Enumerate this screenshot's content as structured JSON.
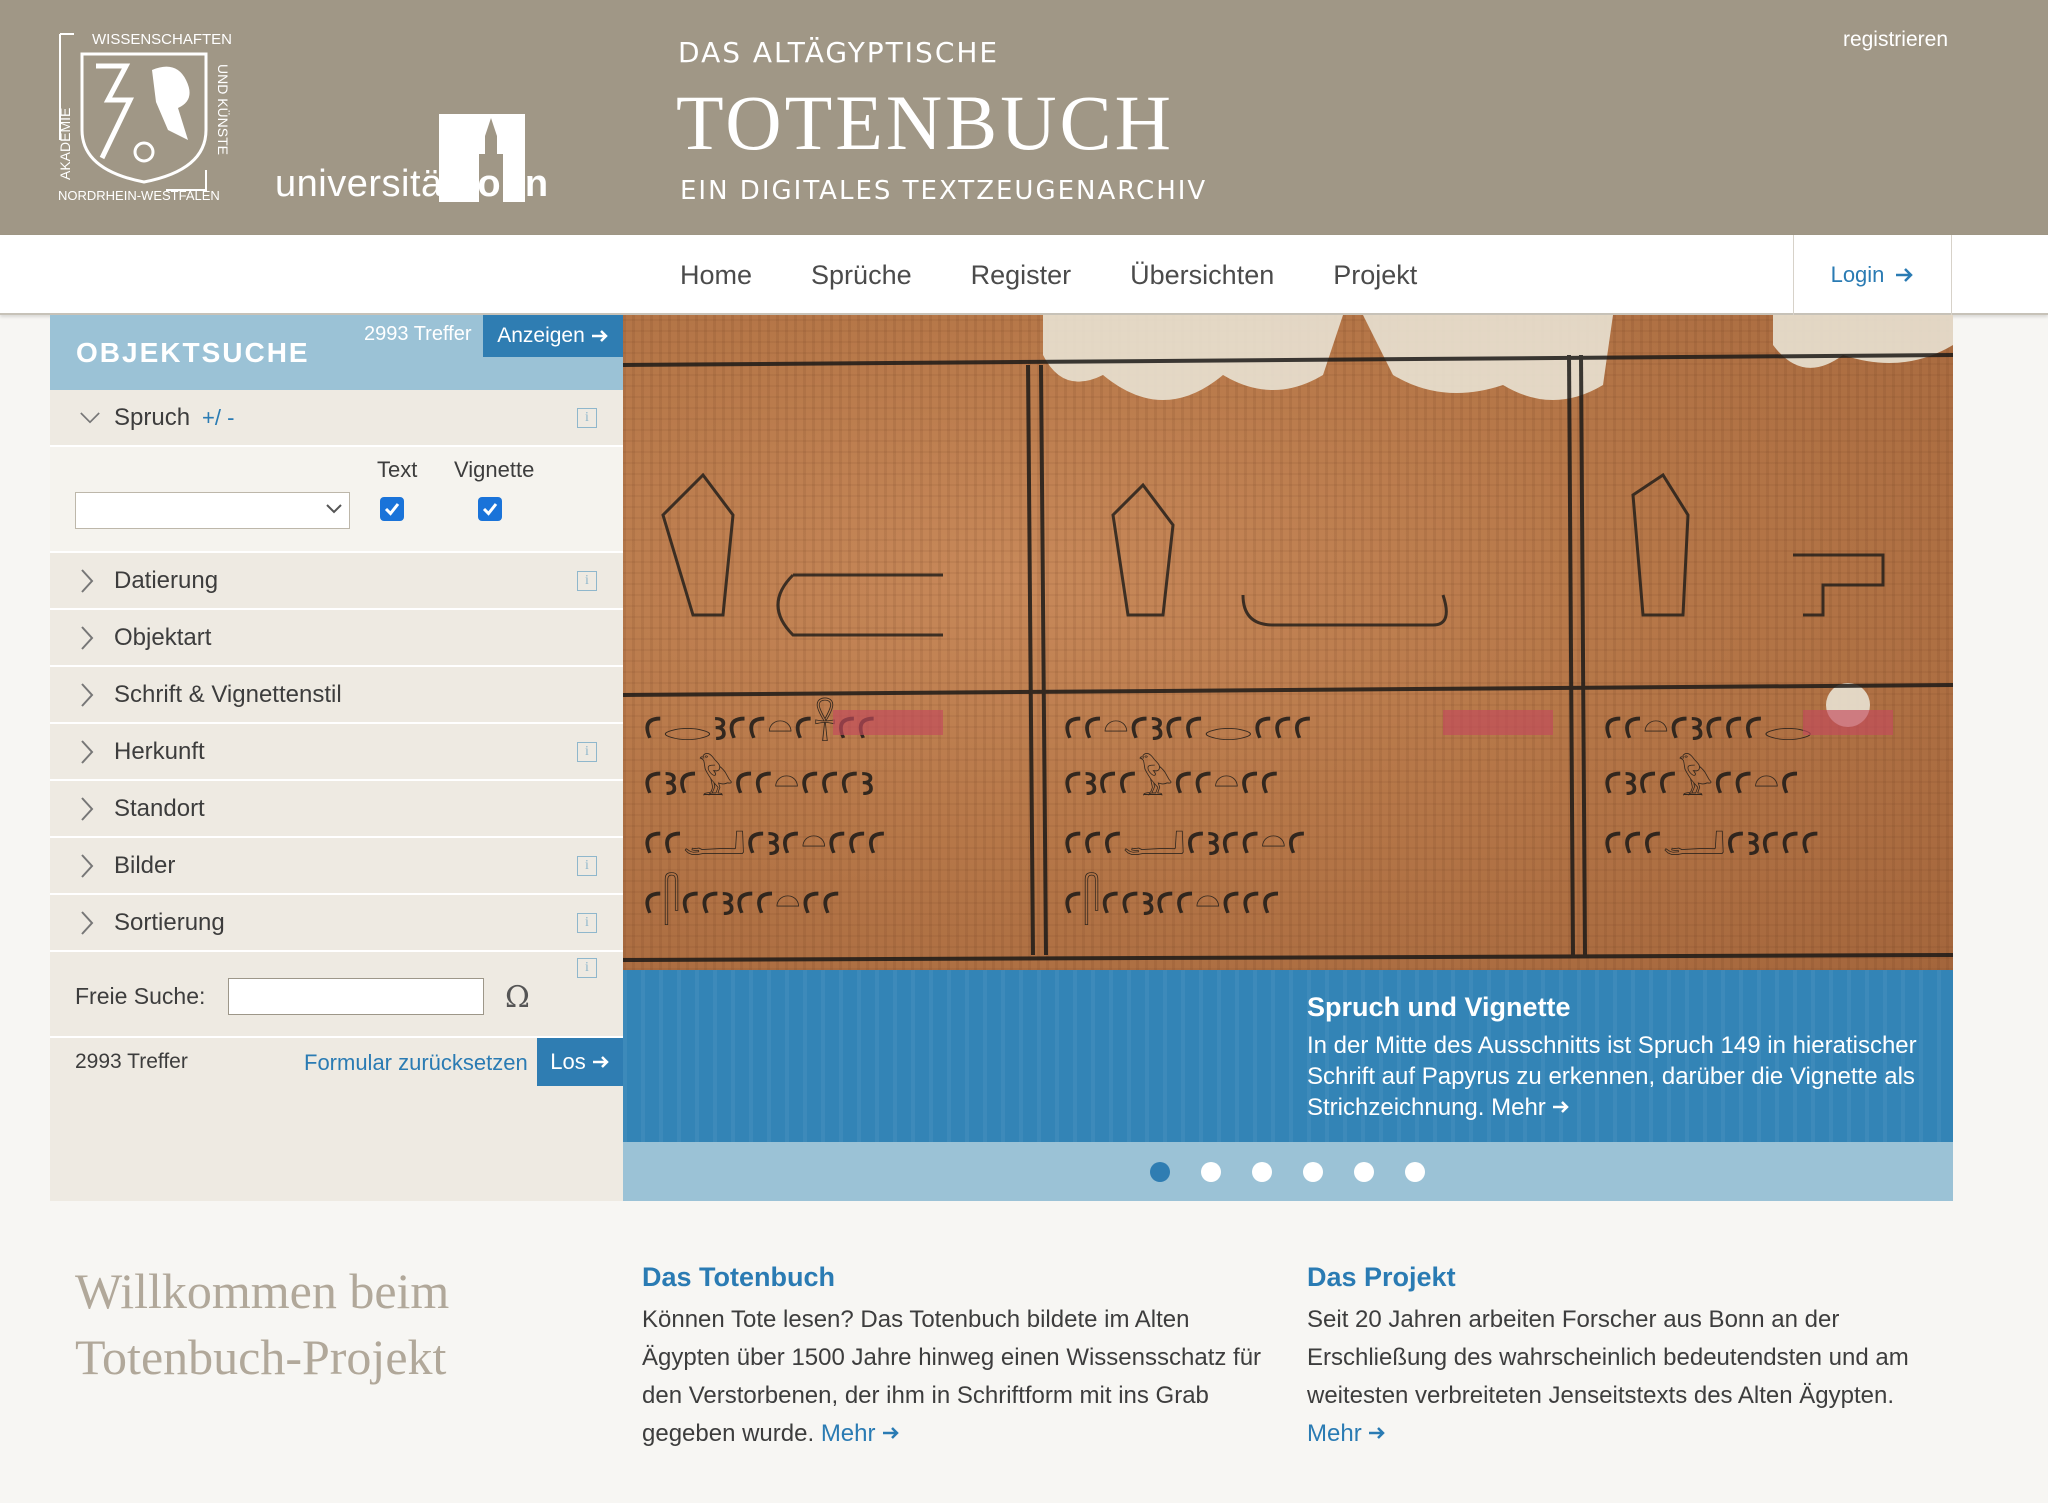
{
  "header": {
    "akademie_logo_text": [
      "WISSENSCHAFTEN",
      "UND KÜNSTE",
      "AKADEMIE",
      "NORDRHEIN-WESTFALEN"
    ],
    "bonn_logo": {
      "light": "universität",
      "bold": "bonn"
    },
    "title_small": "DAS ALTÄGYPTISCHE",
    "title_big": "TOTENBUCH",
    "title_sub": "EIN DIGITALES TEXTZEUGENARCHIV",
    "register_link": "registrieren"
  },
  "nav": {
    "items": [
      "Home",
      "Sprüche",
      "Register",
      "Übersichten",
      "Projekt"
    ],
    "login": "Login"
  },
  "sidebar": {
    "title": "OBJEKTSUCHE",
    "hits_top": "2993 Treffer",
    "show_button": "Anzeigen",
    "spruch": {
      "label": "Spruch",
      "plus_minus": "+/ -",
      "text_label": "Text",
      "vignette_label": "Vignette",
      "text_checked": true,
      "vignette_checked": true,
      "select_value": ""
    },
    "sections": [
      {
        "label": "Datierung",
        "info": true
      },
      {
        "label": "Objektart",
        "info": false
      },
      {
        "label": "Schrift & Vignettenstil",
        "info": false
      },
      {
        "label": "Herkunft",
        "info": true
      },
      {
        "label": "Standort",
        "info": false
      },
      {
        "label": "Bilder",
        "info": true
      },
      {
        "label": "Sortierung",
        "info": true
      }
    ],
    "free_search": {
      "label": "Freie Suche:",
      "value": "",
      "omega": "Ω"
    },
    "hits_bottom": "2993 Treffer",
    "reset_link": "Formular zurücksetzen",
    "go_button": "Los"
  },
  "slider": {
    "caption_title": "Spruch und Vignette",
    "caption_text": "In der Mitte des Ausschnitts ist Spruch 149 in hieratischer Schrift auf Papyrus zu erkennen, darüber die Vignette als Strichzeichnung.",
    "caption_more": "Mehr",
    "slide_count": 6,
    "active_slide": 1
  },
  "welcome": {
    "line1": "Willkommen beim",
    "line2": "Totenbuch-Projekt"
  },
  "columns": [
    {
      "title": "Das Totenbuch",
      "text": "Können Tote lesen? Das Totenbuch bildete im Alten Ägypten über 1500 Jahre hinweg einen Wissensschatz für den Verstorbenen, der ihm in Schriftform mit ins Grab gegeben wurde.",
      "more": "Mehr"
    },
    {
      "title": "Das Projekt",
      "text": "Seit 20 Jahren arbeiten Forscher aus Bonn an der Erschließung des wahrscheinlich bedeutendsten und am weitesten verbreiteten Jenseitstexts des Alten Ägypten.",
      "more": "Mehr"
    }
  ],
  "colors": {
    "header_bg": "#a09786",
    "accent_blue": "#2f7db2",
    "light_blue": "#9bc2d6",
    "sidebar_bg": "#eeeae2",
    "link": "#2a7bb3"
  }
}
